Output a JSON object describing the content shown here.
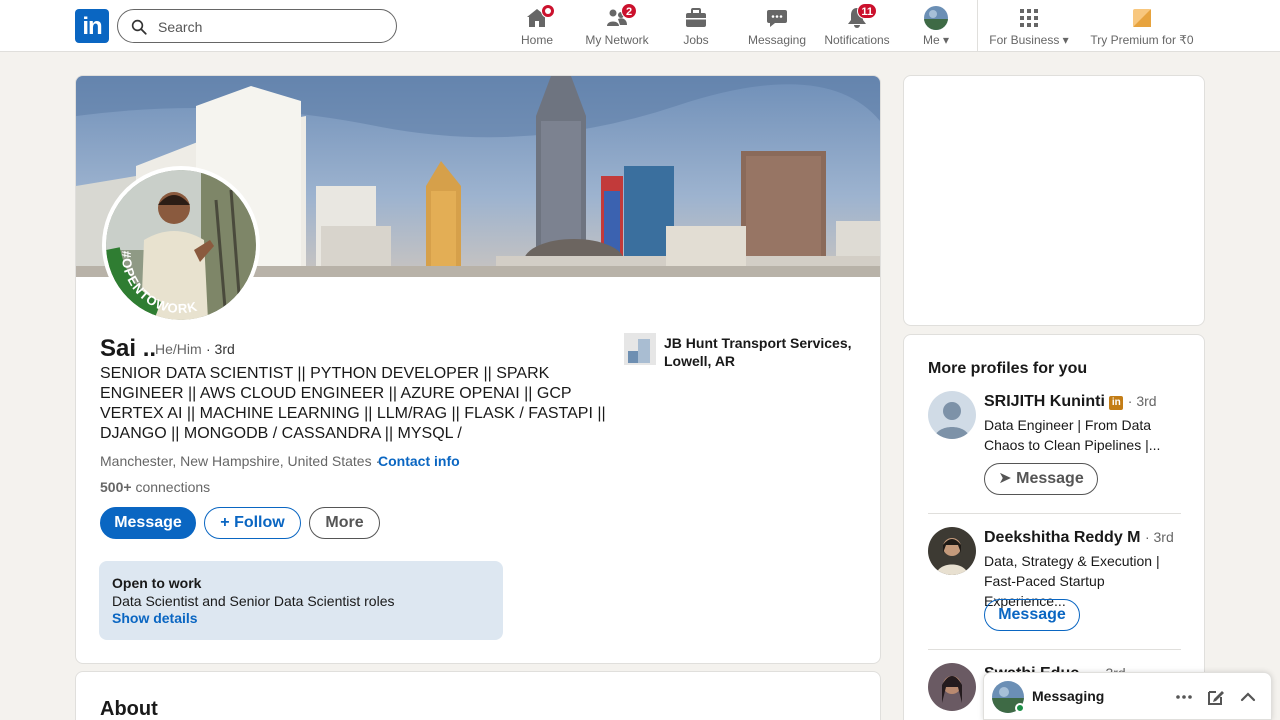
{
  "nav": {
    "logo": "in",
    "search_placeholder": "Search",
    "items": [
      {
        "label": "Home",
        "badge": ""
      },
      {
        "label": "My Network",
        "badge": "2"
      },
      {
        "label": "Jobs",
        "badge": ""
      },
      {
        "label": "Messaging",
        "badge": ""
      },
      {
        "label": "Notifications",
        "badge": "11"
      },
      {
        "label": "Me",
        "badge": ""
      },
      {
        "label": "For Business",
        "badge": ""
      },
      {
        "label": "Try Premium for ₹0",
        "badge": ""
      }
    ]
  },
  "profile": {
    "avatar_frame_text": "#OPENTOWORK",
    "name": "Sai ..",
    "pronouns": "He/Him",
    "degree": "· 3rd",
    "headline": "SENIOR DATA SCIENTIST || PYTHON DEVELOPER || SPARK ENGINEER || AWS CLOUD ENGINEER || AZURE OPENAI || GCP VERTEX AI || MACHINE LEARNING || LLM/RAG || FLASK / FASTAPI || DJANGO || MONGODB / CASSANDRA || MYSQL /",
    "location": "Manchester, New Hampshire, United States ·",
    "contact_info": "Contact info",
    "connections_count": "500+",
    "connections_label": "connections",
    "buttons": {
      "message": "Message",
      "follow": "Follow",
      "more": "More"
    },
    "open_to_work": {
      "title": "Open to work",
      "text": "Data Scientist and Senior Data Scientist roles",
      "link": "Show details"
    },
    "company": "JB Hunt Transport Services, Lowell, AR"
  },
  "about": {
    "title": "About"
  },
  "more_profiles": {
    "title": "More profiles for you",
    "people": [
      {
        "name": "SRIJITH Kuninti",
        "degree": "· 3rd",
        "desc": "Data Engineer | From Data Chaos to Clean Pipelines |...",
        "button": "Message"
      },
      {
        "name": "Deekshitha Reddy M",
        "degree": "· 3rd",
        "desc": "Data, Strategy & Execution | Fast-Paced Startup Experience...",
        "button": "Message"
      },
      {
        "name": "Swathi Educ...",
        "degree": "· 3rd",
        "desc": "",
        "button": ""
      }
    ]
  },
  "messaging_bar": {
    "label": "Messaging"
  },
  "colors": {
    "brand": "#0a66c2",
    "badge": "#cb112d",
    "otw_green": "#2f7d32",
    "otw_bg": "#dde7f1"
  }
}
